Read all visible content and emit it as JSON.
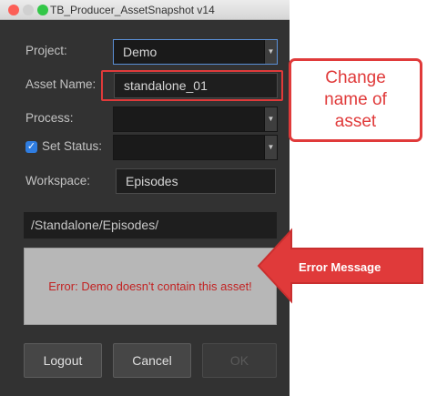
{
  "window": {
    "title": "TB_Producer_AssetSnapshot v14"
  },
  "form": {
    "project_label": "Project:",
    "project_value": "Demo",
    "asset_name_label": "Asset Name:",
    "asset_name_value": "standalone_01",
    "process_label": "Process:",
    "process_value": "",
    "set_status_label": "Set Status:",
    "set_status_checked": true,
    "set_status_value": "",
    "workspace_label": "Workspace:",
    "workspace_value": "Episodes",
    "path_value": "/Standalone/Episodes/",
    "error_message": "Error: Demo doesn't contain this asset!"
  },
  "buttons": {
    "logout": "Logout",
    "cancel": "Cancel",
    "ok": "OK"
  },
  "annotations": {
    "callout_line1": "Change",
    "callout_line2": "name of",
    "callout_line3": "asset",
    "arrow_label": "Error Message"
  },
  "colors": {
    "annotation_red": "#e03a3a",
    "error_text": "#c22424",
    "checkbox_blue": "#2f7de1",
    "dialog_bg": "#323232"
  }
}
